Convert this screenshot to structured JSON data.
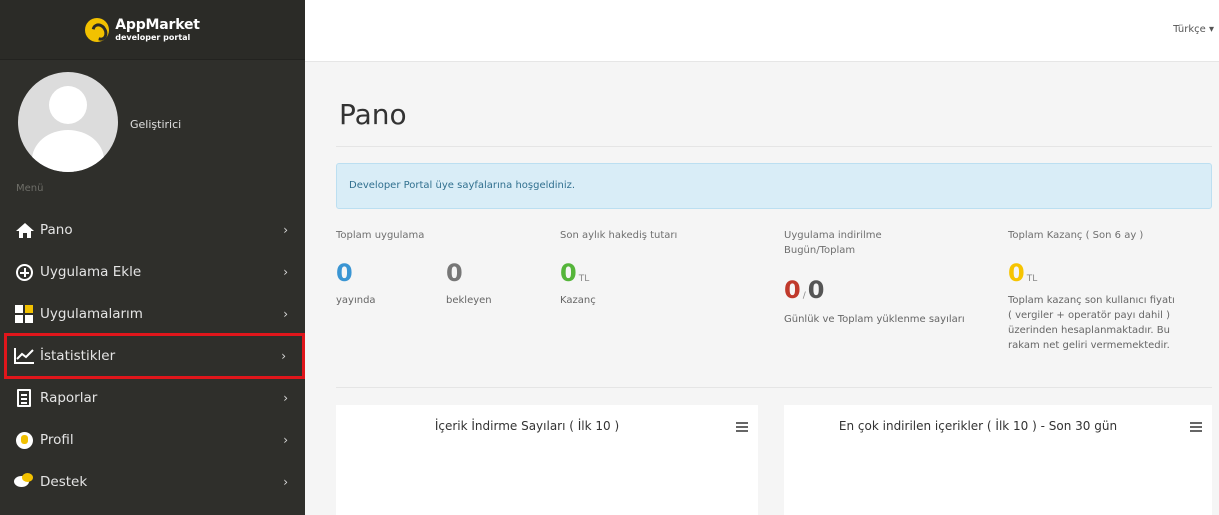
{
  "brand": {
    "name": "AppMarket",
    "subtitle": "developer portal"
  },
  "profile": {
    "name": "Geliştirici"
  },
  "sidebar": {
    "menu_label": "Menü",
    "items": [
      {
        "label": "Pano",
        "icon": "home-icon"
      },
      {
        "label": "Uygulama Ekle",
        "icon": "plus-circle-icon"
      },
      {
        "label": "Uygulamalarım",
        "icon": "grid-icon"
      },
      {
        "label": "İstatistikler",
        "icon": "line-chart-icon",
        "highlighted": true
      },
      {
        "label": "Raporlar",
        "icon": "document-icon"
      },
      {
        "label": "Profil",
        "icon": "profile-icon"
      },
      {
        "label": "Destek",
        "icon": "chat-icon"
      }
    ],
    "chevron": "›"
  },
  "topbar": {
    "language": "Türkçe ▾"
  },
  "main": {
    "title": "Pano",
    "alert": "Developer Portal üye sayfalarına hoşgeldiniz.",
    "stats": {
      "total_apps": {
        "label": "Toplam uygulama",
        "published_value": "0",
        "published_label": "yayında",
        "pending_value": "0",
        "pending_label": "bekleyen"
      },
      "monthly": {
        "label": "Son aylık hakediş tutarı",
        "value": "0",
        "unit": "TL",
        "sub": "Kazanç"
      },
      "downloads": {
        "label_line1": "Uygulama indirilme",
        "label_line2": "Bugün/Toplam",
        "today": "0",
        "separator": "/",
        "total": "0",
        "sub": "Günlük ve Toplam yüklenme sayıları"
      },
      "earnings": {
        "label": "Toplam Kazanç ( Son 6 ay )",
        "value": "0",
        "unit": "TL",
        "note_lines": [
          "Toplam kazanç son kullanıcı fiyatı",
          "( vergiler + operatör payı dahil )",
          "üzerinden hesaplanmaktadır. Bu",
          "rakam net geliri vermemektedir."
        ]
      }
    },
    "panels": [
      {
        "title": "İçerik İndirme Sayıları ( İlk 10 )"
      },
      {
        "title": "En çok indirilen içerikler ( İlk 10 ) - Son 30 gün"
      }
    ]
  },
  "colors": {
    "accent_blue": "#3a95d3",
    "green": "#55b53a",
    "yellow": "#f6c400",
    "red": "#c0392b",
    "highlight": "#e0161b"
  }
}
